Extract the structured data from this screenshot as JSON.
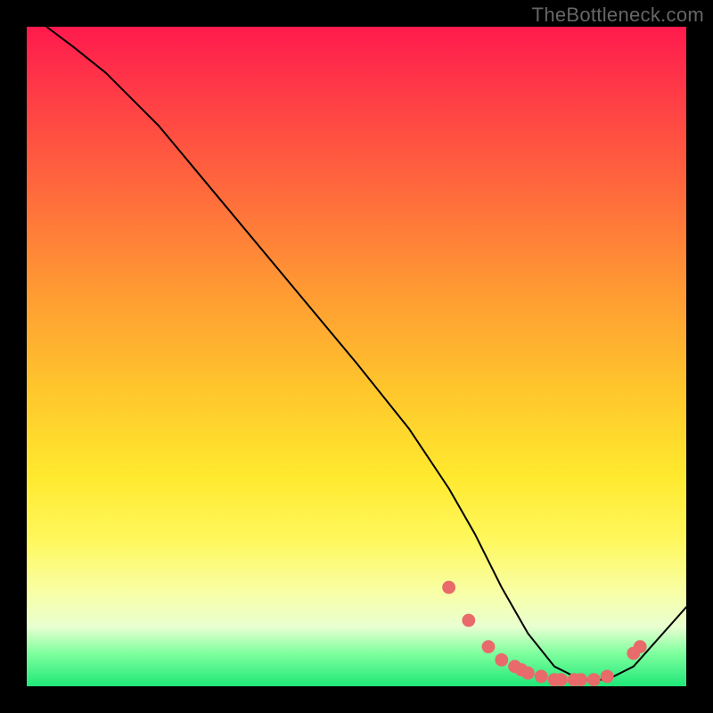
{
  "watermark": "TheBottleneck.com",
  "chart_data": {
    "type": "line",
    "title": "",
    "xlabel": "",
    "ylabel": "",
    "xlim": [
      0,
      100
    ],
    "ylim": [
      0,
      100
    ],
    "series": [
      {
        "name": "curve",
        "x": [
          3,
          7,
          12,
          20,
          30,
          40,
          50,
          58,
          64,
          68,
          72,
          76,
          80,
          84,
          88,
          92,
          100
        ],
        "y": [
          100,
          97,
          93,
          85,
          73,
          61,
          49,
          39,
          30,
          23,
          15,
          8,
          3,
          1,
          1,
          3,
          12
        ]
      }
    ],
    "markers": [
      {
        "x": 64,
        "y": 15
      },
      {
        "x": 67,
        "y": 10
      },
      {
        "x": 70,
        "y": 6
      },
      {
        "x": 72,
        "y": 4
      },
      {
        "x": 74,
        "y": 3
      },
      {
        "x": 75,
        "y": 2.5
      },
      {
        "x": 76,
        "y": 2
      },
      {
        "x": 78,
        "y": 1.5
      },
      {
        "x": 80,
        "y": 1
      },
      {
        "x": 81,
        "y": 1
      },
      {
        "x": 83,
        "y": 1
      },
      {
        "x": 84,
        "y": 1
      },
      {
        "x": 86,
        "y": 1
      },
      {
        "x": 88,
        "y": 1.5
      },
      {
        "x": 92,
        "y": 5
      },
      {
        "x": 93,
        "y": 6
      }
    ],
    "colors": {
      "curve": "#000000",
      "markers": "#e86a6a",
      "gradient_top": "#ff1a4d",
      "gradient_bottom": "#1fe879"
    }
  }
}
